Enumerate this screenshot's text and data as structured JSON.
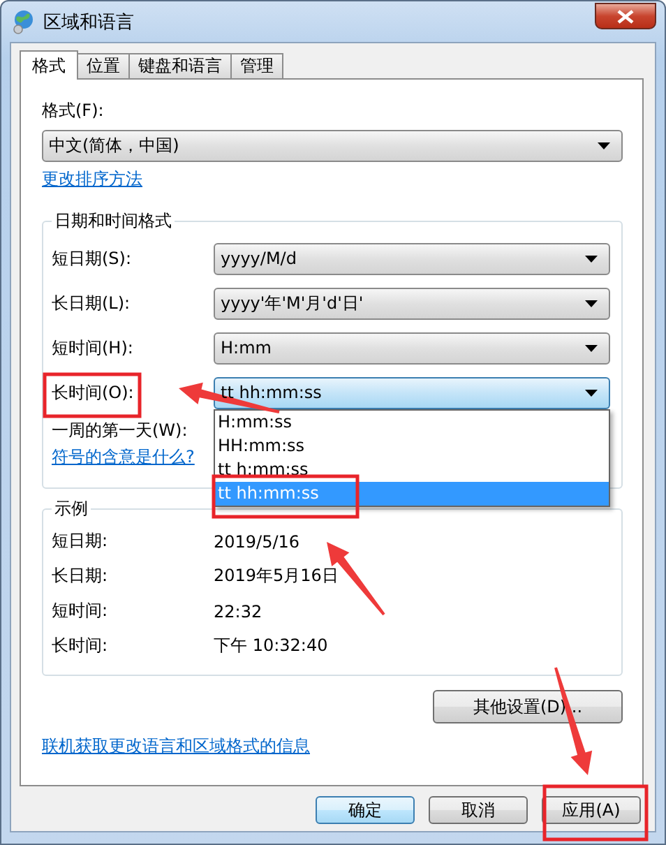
{
  "window": {
    "title": "区域和语言"
  },
  "tabs": [
    {
      "label": "格式",
      "selected": true
    },
    {
      "label": "位置",
      "selected": false
    },
    {
      "label": "键盘和语言",
      "selected": false
    },
    {
      "label": "管理",
      "selected": false
    }
  ],
  "format": {
    "label": "格式(F):",
    "value": "中文(简体，中国)"
  },
  "sort_link": "更改排序方法",
  "date_time_formats": {
    "title": "日期和时间格式",
    "rows": [
      {
        "label": "短日期(S):",
        "value": "yyyy/M/d",
        "open": false
      },
      {
        "label": "长日期(L):",
        "value": "yyyy'年'M'月'd'日'",
        "open": false
      },
      {
        "label": "短时间(H):",
        "value": "H:mm",
        "open": false
      },
      {
        "label": "长时间(O):",
        "value": "tt hh:mm:ss",
        "open": true,
        "options": [
          {
            "text": "H:mm:ss",
            "selected": false
          },
          {
            "text": "HH:mm:ss",
            "selected": false
          },
          {
            "text": "tt h:mm:ss",
            "selected": false
          },
          {
            "text": "tt hh:mm:ss",
            "selected": true
          }
        ]
      }
    ],
    "first_day_label": "一周的第一天(W):",
    "help_link": "符号的含意是什么?"
  },
  "examples": {
    "title": "示例",
    "rows": [
      {
        "label": "短日期:",
        "value": "2019/5/16"
      },
      {
        "label": "长日期:",
        "value": "2019年5月16日"
      },
      {
        "label": "短时间:",
        "value": "22:32"
      },
      {
        "label": "长时间:",
        "value": "下午 10:32:40"
      }
    ]
  },
  "other_settings_button": "其他设置(D)...",
  "online_link": "联机获取更改语言和区域格式的信息",
  "buttons": [
    {
      "label": "确定",
      "default": true
    },
    {
      "label": "取消",
      "default": false
    },
    {
      "label": "应用(A)",
      "default": false
    }
  ],
  "annotations": [
    {
      "kind": "box"
    },
    {
      "kind": "arrow"
    },
    {
      "kind": "box"
    },
    {
      "kind": "arrow"
    },
    {
      "kind": "arrow"
    },
    {
      "kind": "box"
    }
  ]
}
